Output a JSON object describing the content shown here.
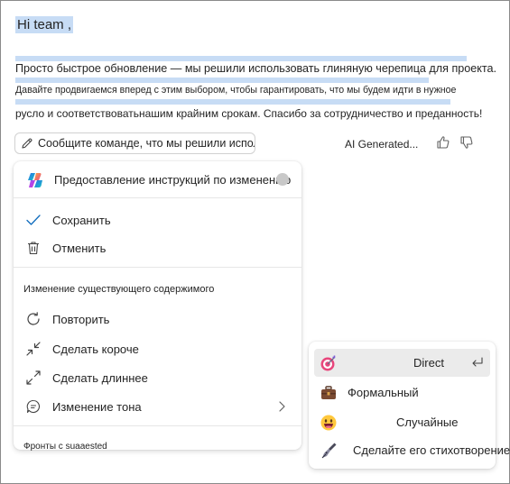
{
  "document": {
    "greeting": "Hi team ,",
    "lines": [
      "Просто быстрое обновление — мы решили использовать глиняную черепица для проекта.",
      "Давайте продвигаемся вперед с этим выбором, чтобы гарантировать, что мы будем идти в нужное",
      "русло и соответствоватьнашим крайним срокам. Спасибо за сотрудничество и преданность!"
    ],
    "highlight_color": "#c7dcf5"
  },
  "prompt": {
    "text": "Сообщите команде, что мы решили использовать...",
    "icon": "pencil-icon",
    "ai_label": "AI Generated...",
    "like_icon": "thumbs-up-icon",
    "dislike_icon": "thumbs-down-icon"
  },
  "menu": {
    "title": "Предоставление инструкций по изменению",
    "logo": "copilot-logo-icon",
    "actions": [
      {
        "label": "Сохранить",
        "icon": "checkmark-icon"
      },
      {
        "label": "Отменить",
        "icon": "trash-icon"
      }
    ],
    "section_label": "Изменение существующего содержимого",
    "edit_items": [
      {
        "label": "Повторить",
        "icon": "refresh-icon"
      },
      {
        "label": "Сделать короче",
        "icon": "shrink-arrows-icon"
      },
      {
        "label": "Сделать длиннее",
        "icon": "expand-arrows-icon"
      },
      {
        "label": "Изменение тона",
        "icon": "chat-bubble-icon"
      }
    ],
    "footer_text": "Фронты с suaaested"
  },
  "submenu": {
    "items": [
      {
        "label": "Direct",
        "icon": "target-icon",
        "active": true
      },
      {
        "label": "Формальный",
        "icon": "briefcase-icon"
      },
      {
        "label": "Случайные",
        "icon": "grinning-face-icon"
      },
      {
        "label": "Сделайте его стихотворением",
        "icon": "fountain-pen-icon"
      }
    ],
    "enter_icon": "enter-return-icon"
  }
}
